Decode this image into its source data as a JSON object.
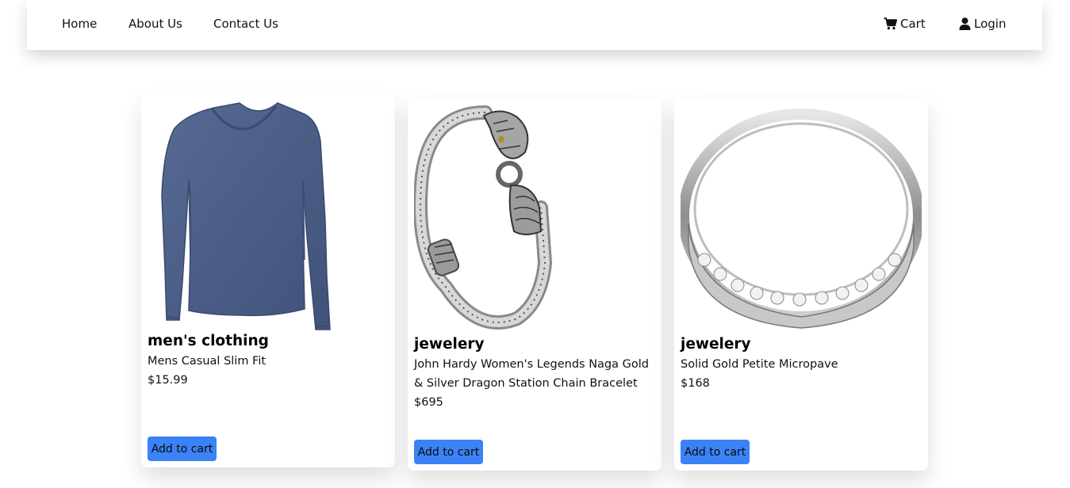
{
  "nav": {
    "home": "Home",
    "about": "About Us",
    "contact": "Contact Us",
    "cart": "Cart",
    "login": "Login"
  },
  "products": [
    {
      "category": "men's clothing",
      "title": "Mens Casual Slim Fit",
      "price": "$15.99",
      "button": "Add to cart",
      "image": "blue-long-sleeve-shirt"
    },
    {
      "category": "jewelery",
      "title": "John Hardy Women's Legends Naga Gold & Silver Dragon Station Chain Bracelet",
      "price": "$695",
      "button": "Add to cart",
      "image": "silver-dragon-bracelet"
    },
    {
      "category": "jewelery",
      "title": "Solid Gold Petite Micropave",
      "price": "$168",
      "button": "Add to cart",
      "image": "silver-micropave-ring"
    }
  ],
  "colors": {
    "button": "#3b82f6",
    "shirt": "#4d6089"
  }
}
